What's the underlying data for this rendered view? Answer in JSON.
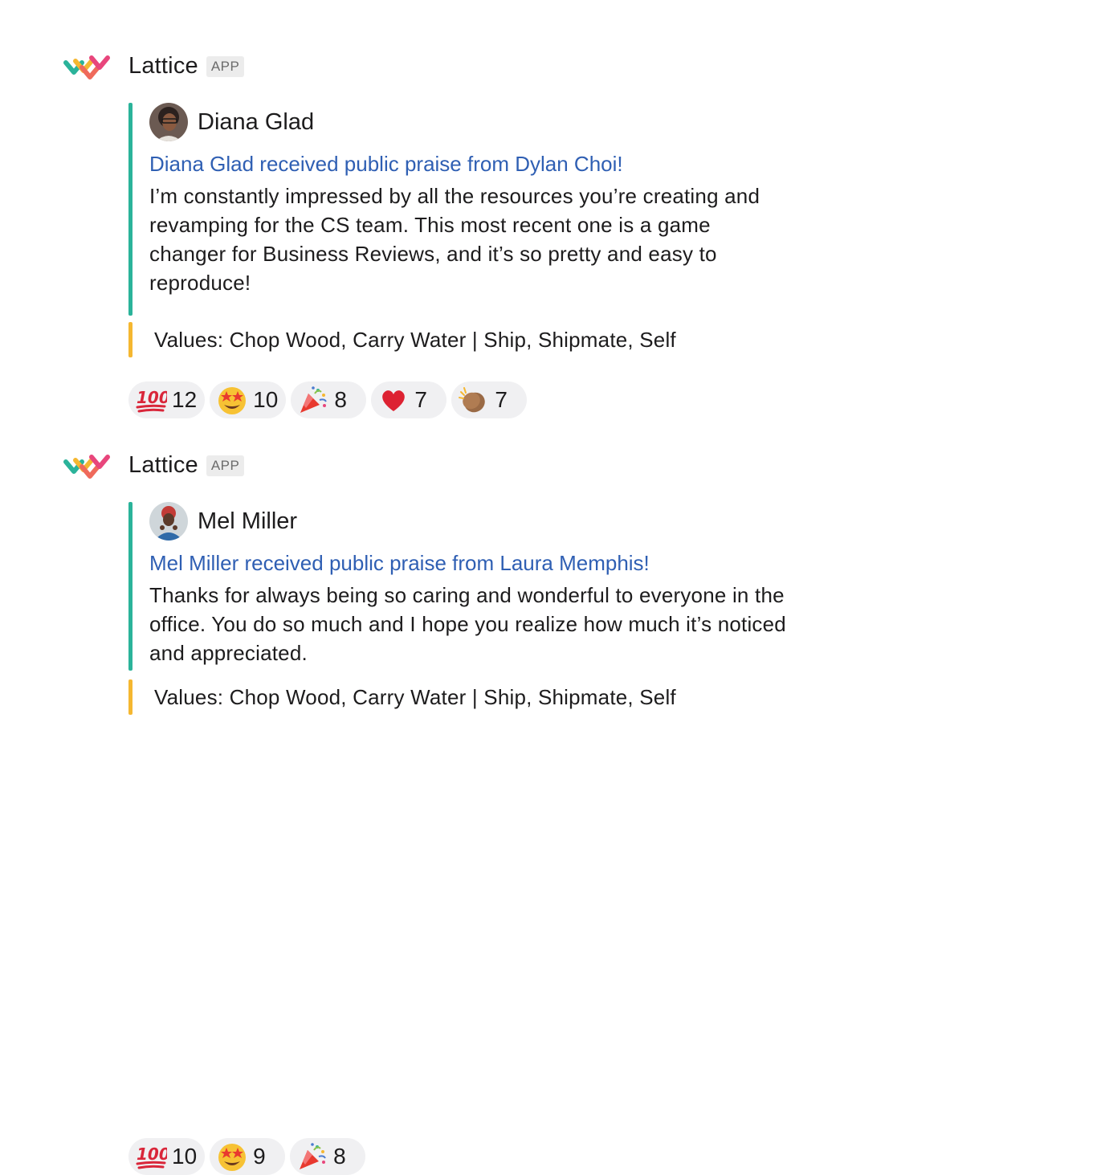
{
  "messages": [
    {
      "app_name": "Lattice",
      "app_badge": "APP",
      "author": "Diana Glad",
      "title": "Diana Glad received public praise from Dylan Choi!",
      "text": "I’m constantly impressed by all the resources you’re creating and revamping for the CS team. This most recent one is a game changer for Business Reviews, and it’s so pretty and easy to reproduce!",
      "values_label": "Values:",
      "values_text": "Chop Wood, Carry Water | Ship, Shipmate, Self",
      "reactions": [
        {
          "emoji": "hundred-points",
          "count": "12"
        },
        {
          "emoji": "star-struck",
          "count": "10"
        },
        {
          "emoji": "party-popper",
          "count": "8"
        },
        {
          "emoji": "red-heart",
          "count": "7"
        },
        {
          "emoji": "clapping-hands",
          "count": "7"
        }
      ]
    },
    {
      "app_name": "Lattice",
      "app_badge": "APP",
      "author": "Mel Miller",
      "title": "Mel Miller received public praise from Laura Memphis!",
      "text": "Thanks for always being so caring and wonderful to everyone in the office. You do so much and I hope you realize how much it’s noticed and appreciated.",
      "values_label": "Values:",
      "values_text": "Chop Wood, Carry Water | Ship, Shipmate, Self",
      "reactions": [
        {
          "emoji": "hundred-points",
          "count": "10"
        },
        {
          "emoji": "star-struck",
          "count": "9"
        },
        {
          "emoji": "party-popper",
          "count": "8"
        }
      ]
    }
  ],
  "colors": {
    "attachment_bar": "#2bb39a",
    "values_bar": "#f5b731",
    "link": "#2f5fb3",
    "reaction_bg": "#f0f0f2"
  }
}
